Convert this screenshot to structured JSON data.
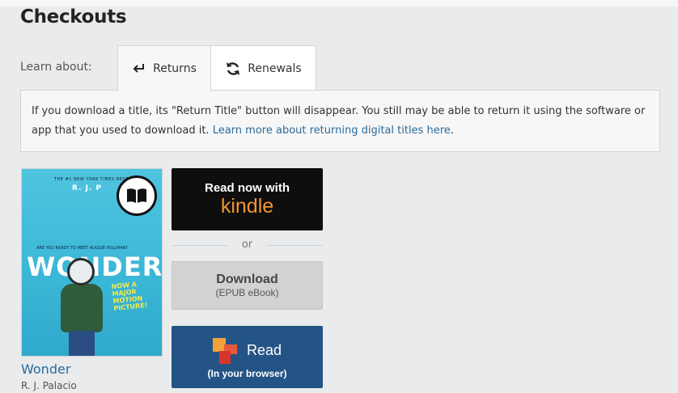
{
  "page": {
    "title": "Checkouts"
  },
  "learn": {
    "label": "Learn about:",
    "tabs": [
      {
        "label": "Returns",
        "icon": "return-arrow-icon",
        "active": true
      },
      {
        "label": "Renewals",
        "icon": "refresh-icon",
        "active": false
      }
    ]
  },
  "info": {
    "text": "If you download a title, its \"Return Title\" button will disappear. You still may be able to return it using the software or app that you used to download it. ",
    "link": "Learn more about returning digital titles here",
    "tail": "."
  },
  "book": {
    "title": "Wonder",
    "author": "R. J. Palacio",
    "format_icon": "book-icon",
    "cover": {
      "author_text": "R. J. P",
      "title_text": "WONDER",
      "tagline": "ARE YOU READY TO MEET AUGGIE PULLMAN?",
      "movie_text": "NOW A MAJOR MOTION PICTURE!"
    }
  },
  "actions": {
    "kindle": {
      "line1": "Read now with",
      "brand": "kindle"
    },
    "or": "or",
    "download": {
      "main": "Download",
      "sub": "(EPUB eBook)"
    },
    "read": {
      "main": "Read",
      "sub": "(In your browser)"
    }
  },
  "colors": {
    "background": "#e9ebec",
    "link": "#2b6a9a",
    "kindle_bg": "#0e0e0e",
    "kindle_brand": "#f29530",
    "read_bg": "#245486",
    "download_bg": "#d2d2d2"
  }
}
